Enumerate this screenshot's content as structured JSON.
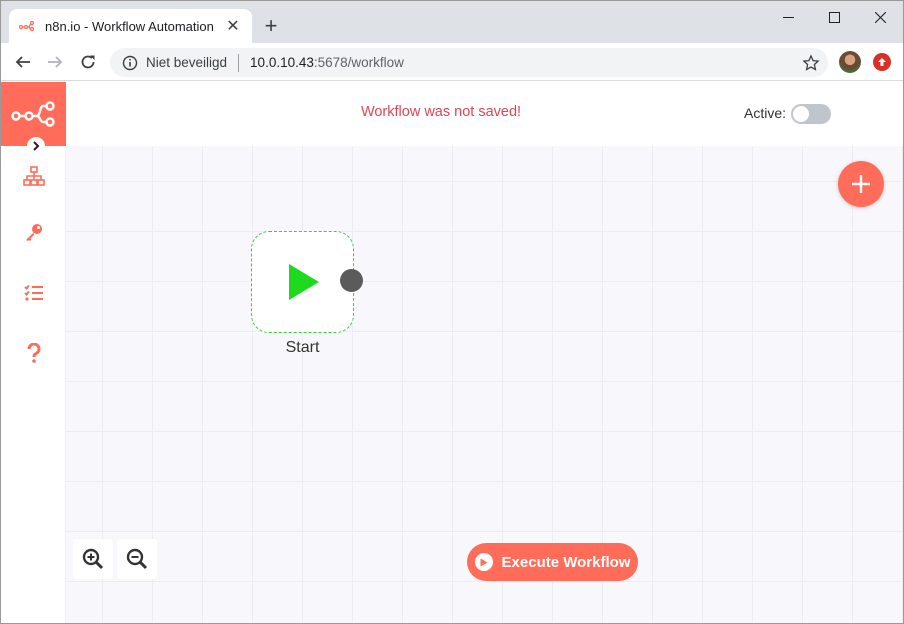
{
  "browser": {
    "tab_title": "n8n.io - Workflow Automation",
    "new_tab": "+",
    "url_security": "Niet beveiligd",
    "url_host": "10.0.10.43",
    "url_rest": ":5678/workflow"
  },
  "header": {
    "status": "Workflow was not saved!",
    "active_label": "Active:",
    "active": false
  },
  "sidebar": {
    "items": [
      {
        "icon": "network-icon",
        "label": "Workflows"
      },
      {
        "icon": "key-icon",
        "label": "Credentials"
      },
      {
        "icon": "list-check-icon",
        "label": "Executions"
      },
      {
        "icon": "question-icon",
        "label": "Help"
      }
    ]
  },
  "canvas": {
    "node": {
      "label": "Start",
      "icon": "play-icon"
    },
    "execute_label": "Execute Workflow"
  },
  "colors": {
    "brand": "#ff6d5a",
    "status": "#dc4656",
    "node_border": "#3ec93e",
    "play": "#1ed91e"
  }
}
